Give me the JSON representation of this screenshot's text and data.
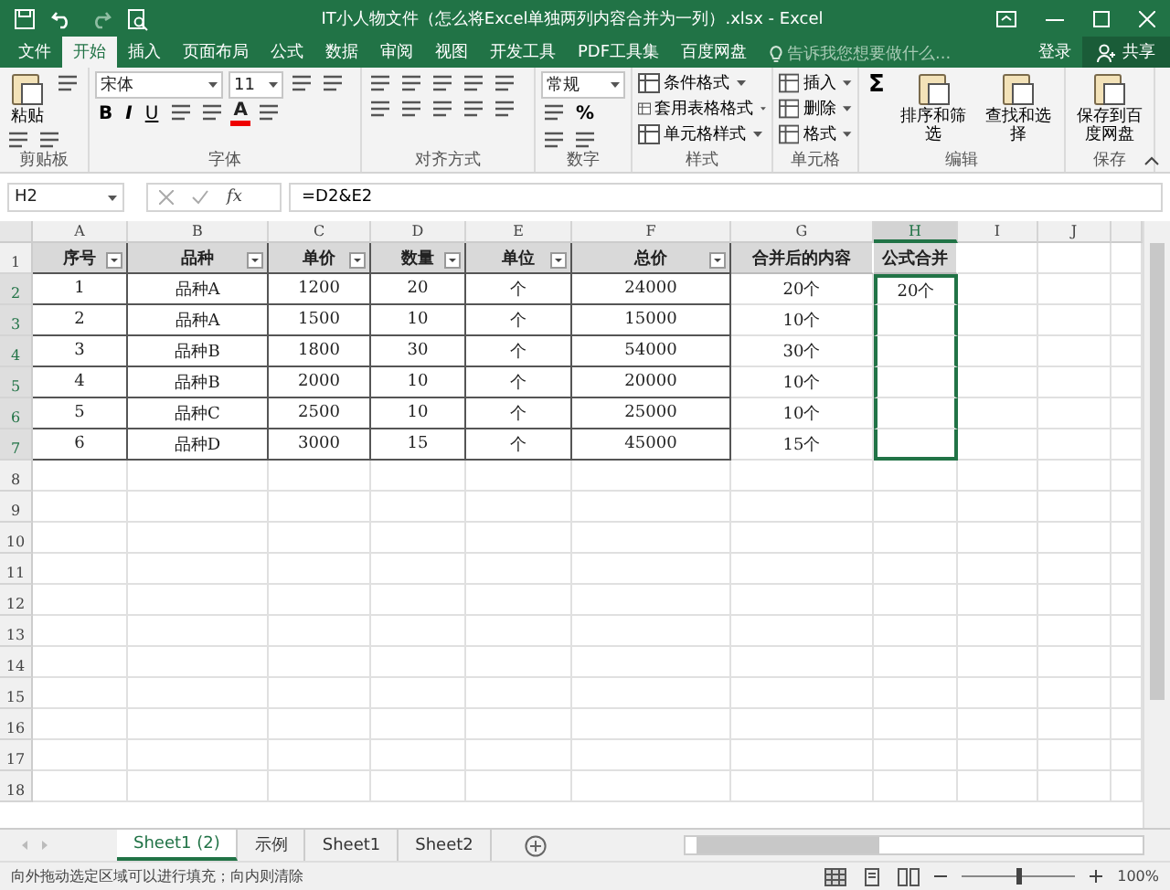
{
  "window": {
    "title": "IT小人物文件（怎么将Excel单独两列内容合并为一列）.xlsx - Excel"
  },
  "menu_tabs": [
    {
      "label": "文件",
      "selected": false
    },
    {
      "label": "开始",
      "selected": true
    },
    {
      "label": "插入",
      "selected": false
    },
    {
      "label": "页面布局",
      "selected": false
    },
    {
      "label": "公式",
      "selected": false
    },
    {
      "label": "数据",
      "selected": false
    },
    {
      "label": "审阅",
      "selected": false
    },
    {
      "label": "视图",
      "selected": false
    },
    {
      "label": "开发工具",
      "selected": false
    },
    {
      "label": "PDF工具集",
      "selected": false
    },
    {
      "label": "百度网盘",
      "selected": false
    }
  ],
  "tell_me": {
    "placeholder": "告诉我您想要做什么..."
  },
  "account": {
    "login": "登录",
    "share": "共享"
  },
  "ribbon": [
    {
      "label": "剪贴板",
      "items": [
        {
          "kind": "large",
          "label": "粘贴"
        },
        {
          "kind": "icon"
        },
        {
          "kind": "icon"
        },
        {
          "kind": "icon"
        }
      ]
    },
    {
      "label": "字体",
      "items": [
        {
          "kind": "dropdown",
          "label": "宋体"
        },
        {
          "kind": "dropdown",
          "label": "11"
        },
        {
          "kind": "icon"
        },
        {
          "kind": "icon"
        },
        {
          "kind": "glyph",
          "label": "B"
        },
        {
          "kind": "glyph",
          "label": "I"
        },
        {
          "kind": "glyph",
          "label": "U"
        },
        {
          "kind": "icon"
        },
        {
          "kind": "icon"
        },
        {
          "kind": "glyph",
          "label": "A"
        },
        {
          "kind": "icon"
        }
      ]
    },
    {
      "label": "对齐方式",
      "items": [
        {
          "kind": "icon"
        },
        {
          "kind": "icon"
        },
        {
          "kind": "icon"
        },
        {
          "kind": "icon"
        },
        {
          "kind": "icon"
        },
        {
          "kind": "icon"
        },
        {
          "kind": "icon"
        },
        {
          "kind": "icon"
        },
        {
          "kind": "icon"
        },
        {
          "kind": "icon"
        }
      ]
    },
    {
      "label": "数字",
      "items": [
        {
          "kind": "dropdown",
          "label": "常规"
        },
        {
          "kind": "icon"
        },
        {
          "kind": "glyph",
          "label": "%"
        },
        {
          "kind": "icon"
        },
        {
          "kind": "icon"
        }
      ]
    },
    {
      "label": "样式",
      "items": [
        {
          "kind": "small",
          "label": "条件格式"
        },
        {
          "kind": "small",
          "label": "套用表格格式"
        },
        {
          "kind": "small",
          "label": "单元格样式"
        }
      ]
    },
    {
      "label": "单元格",
      "items": [
        {
          "kind": "small",
          "label": "插入"
        },
        {
          "kind": "small",
          "label": "删除"
        },
        {
          "kind": "small",
          "label": "格式"
        }
      ]
    },
    {
      "label": "编辑",
      "items": [
        {
          "kind": "glyph",
          "label": "Σ"
        },
        {
          "kind": "large",
          "label": "排序和筛选"
        },
        {
          "kind": "large",
          "label": "查找和选择"
        }
      ]
    },
    {
      "label": "保存",
      "items": [
        {
          "kind": "large",
          "label": "保存到百度网盘"
        }
      ]
    }
  ],
  "formula_bar": {
    "name_box": "H2",
    "function_button": "fx",
    "formula": "=D2&E2"
  },
  "columns": [
    {
      "letter": "A",
      "kind": "table",
      "selected": false
    },
    {
      "letter": "B",
      "kind": "table",
      "selected": false
    },
    {
      "letter": "C",
      "kind": "table",
      "selected": false
    },
    {
      "letter": "D",
      "kind": "table",
      "selected": false
    },
    {
      "letter": "E",
      "kind": "table",
      "selected": false
    },
    {
      "letter": "F",
      "kind": "table",
      "selected": false
    },
    {
      "letter": "G",
      "kind": "plain",
      "selected": false
    },
    {
      "letter": "H",
      "kind": "plain",
      "selected": true
    },
    {
      "letter": "I",
      "kind": "empty",
      "selected": false
    },
    {
      "letter": "J",
      "kind": "empty",
      "selected": false
    }
  ],
  "rows": [
    {
      "number": "1",
      "kind": "header",
      "selected": false,
      "cells": [
        "序号",
        "品种",
        "单价",
        "数量",
        "单位",
        "总价",
        "合并后的内容",
        "公式合并"
      ]
    },
    {
      "number": "2",
      "kind": "data",
      "selected": true,
      "cells": [
        "1",
        "品种A",
        "1200",
        "20",
        "个",
        "24000",
        "20个",
        "20个"
      ]
    },
    {
      "number": "3",
      "kind": "data",
      "selected": true,
      "cells": [
        "2",
        "品种A",
        "1500",
        "10",
        "个",
        "15000",
        "10个",
        ""
      ]
    },
    {
      "number": "4",
      "kind": "data",
      "selected": true,
      "cells": [
        "3",
        "品种B",
        "1800",
        "30",
        "个",
        "54000",
        "30个",
        ""
      ]
    },
    {
      "number": "5",
      "kind": "data",
      "selected": true,
      "cells": [
        "4",
        "品种B",
        "2000",
        "10",
        "个",
        "20000",
        "10个",
        ""
      ]
    },
    {
      "number": "6",
      "kind": "data",
      "selected": true,
      "cells": [
        "5",
        "品种C",
        "2500",
        "10",
        "个",
        "25000",
        "10个",
        ""
      ]
    },
    {
      "number": "7",
      "kind": "data",
      "selected": true,
      "cells": [
        "6",
        "品种D",
        "3000",
        "15",
        "个",
        "45000",
        "15个",
        ""
      ]
    },
    {
      "number": "8",
      "kind": "empty",
      "selected": false,
      "cells": []
    },
    {
      "number": "9",
      "kind": "empty",
      "selected": false,
      "cells": []
    },
    {
      "number": "10",
      "kind": "empty",
      "selected": false,
      "cells": []
    },
    {
      "number": "11",
      "kind": "empty",
      "selected": false,
      "cells": []
    },
    {
      "number": "12",
      "kind": "empty",
      "selected": false,
      "cells": []
    },
    {
      "number": "13",
      "kind": "empty",
      "selected": false,
      "cells": []
    },
    {
      "number": "14",
      "kind": "empty",
      "selected": false,
      "cells": []
    },
    {
      "number": "15",
      "kind": "empty",
      "selected": false,
      "cells": []
    },
    {
      "number": "16",
      "kind": "empty",
      "selected": false,
      "cells": []
    },
    {
      "number": "17",
      "kind": "empty",
      "selected": false,
      "cells": []
    },
    {
      "number": "18",
      "kind": "empty",
      "selected": false,
      "cells": []
    }
  ],
  "sheet_tabs": [
    {
      "label": "Sheet1 (2)",
      "selected": true
    },
    {
      "label": "示例",
      "selected": false
    },
    {
      "label": "Sheet1",
      "selected": false
    },
    {
      "label": "Sheet2",
      "selected": false
    }
  ],
  "status_bar": {
    "message": "向外拖动选定区域可以进行填充；向内则清除",
    "zoom": {
      "level": 0.5,
      "reading": "100%"
    }
  }
}
